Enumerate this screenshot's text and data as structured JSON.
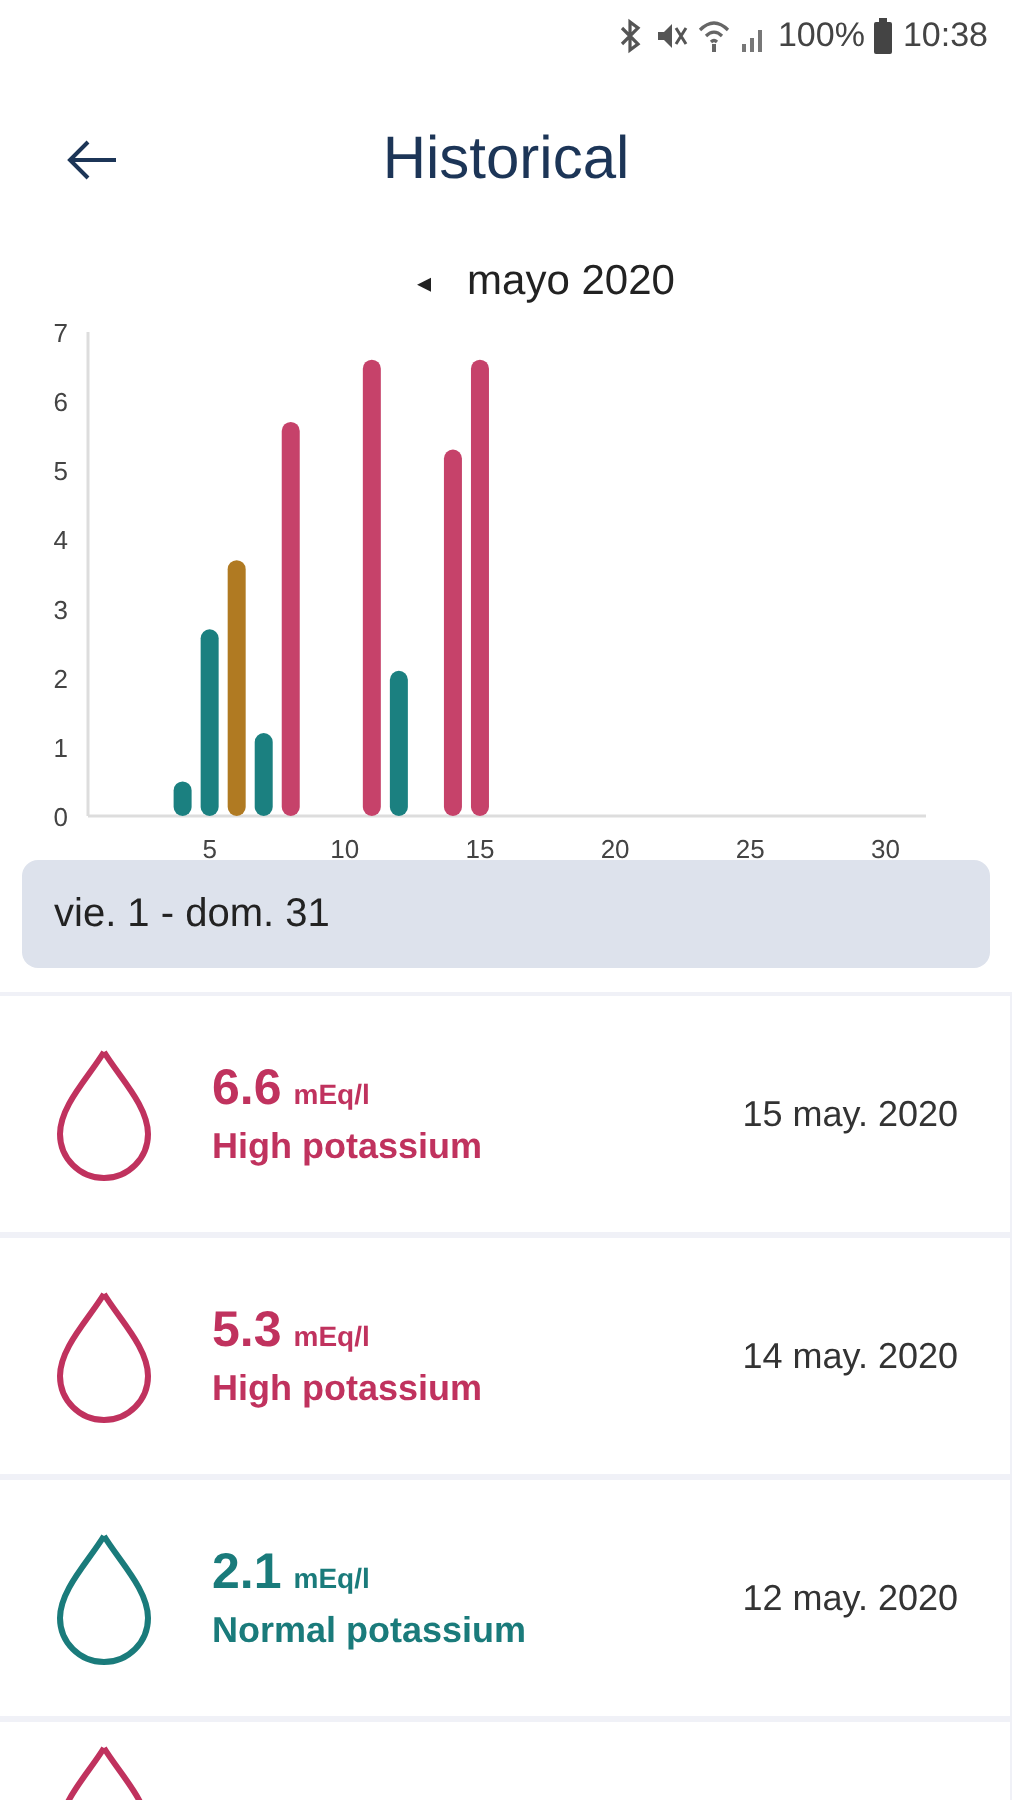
{
  "status_bar": {
    "battery": "100%",
    "time": "10:38"
  },
  "header": {
    "title": "Historical"
  },
  "month_nav": {
    "prev": "◂",
    "label": "mayo 2020"
  },
  "chart": {
    "chart_data": {
      "type": "bar",
      "x": [
        4,
        5,
        6,
        7,
        8,
        11,
        12,
        14,
        15
      ],
      "xlim": [
        0.5,
        31.5
      ],
      "ylim": [
        0,
        7
      ],
      "xticks": [
        5,
        10,
        15,
        20,
        25,
        30
      ],
      "yticks": [
        0,
        1,
        2,
        3,
        4,
        5,
        6,
        7
      ],
      "stacked": true,
      "series": [
        {
          "color": "#1b8080",
          "values": [
            0.5,
            2.7,
            null,
            1.2,
            null,
            null,
            2.1,
            null,
            null
          ]
        },
        {
          "color": "#b07a22",
          "values": [
            null,
            null,
            3.7,
            null,
            null,
            null,
            null,
            null,
            null
          ]
        },
        {
          "color": "#c6426a",
          "values": [
            null,
            null,
            null,
            null,
            5.7,
            6.6,
            null,
            5.3,
            6.6
          ]
        }
      ]
    }
  },
  "range": {
    "label": "vie. 1 - dom. 31"
  },
  "readings": [
    {
      "color": "#c0325e",
      "value": "6.6",
      "unit": "mEq/l",
      "label": "High potassium",
      "date": "15 may. 2020"
    },
    {
      "color": "#c0325e",
      "value": "5.3",
      "unit": "mEq/l",
      "label": "High potassium",
      "date": "14 may. 2020"
    },
    {
      "color": "#1a7b7b",
      "value": "2.1",
      "unit": "mEq/l",
      "label": "Normal potassium",
      "date": "12 may. 2020"
    },
    {
      "color": "#c0325e"
    }
  ]
}
